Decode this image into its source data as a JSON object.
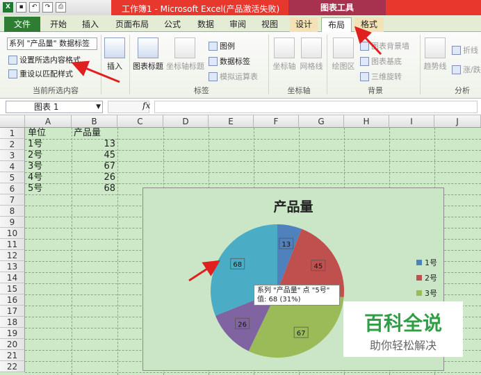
{
  "window": {
    "title": "工作簿1 - Microsoft Excel(产品激活失败)",
    "chart_tools_label": "图表工具",
    "qat_icons": [
      "excel-app-icon",
      "save-icon",
      "undo-icon",
      "redo-icon",
      "print-preview-icon"
    ]
  },
  "tabs": [
    "文件",
    "开始",
    "插入",
    "页面布局",
    "公式",
    "数据",
    "审阅",
    "视图",
    "设计",
    "布局",
    "格式"
  ],
  "active_tab": "布局",
  "ribbon": {
    "current_selection": {
      "dropdown_value": "系列 \"产品量\" 数据标签",
      "format_selection": "设置所选内容格式",
      "reset_style": "重设以匹配样式",
      "group_label": "当前所选内容"
    },
    "insert": {
      "label": "插入"
    },
    "labels": {
      "chart_title": "图表标题",
      "axis_title": "坐标轴标题",
      "legend": "图例",
      "data_labels": "数据标签",
      "data_table": "模拟运算表",
      "group_label": "标签"
    },
    "axes": {
      "axes": "坐标轴",
      "gridlines": "网格线",
      "group_label": "坐标轴"
    },
    "background": {
      "plot_area": "绘图区",
      "chart_wall": "图表背景墙",
      "chart_floor": "图表基底",
      "rotation": "三维旋转",
      "group_label": "背景"
    },
    "analysis": {
      "trendline": "趋势线",
      "lines": "折线",
      "updown": "涨/跌",
      "group_label": "分析"
    }
  },
  "formula_bar": {
    "name_box": "图表 1",
    "fx": "fx",
    "formula": ""
  },
  "sheet": {
    "columns": [
      "A",
      "B",
      "C",
      "D",
      "E",
      "F",
      "G",
      "H",
      "I",
      "J"
    ],
    "rows": [
      "1",
      "2",
      "3",
      "4",
      "5",
      "6",
      "7",
      "8",
      "9",
      "10",
      "11",
      "12",
      "13",
      "14",
      "15",
      "16",
      "17",
      "18",
      "19",
      "20",
      "21",
      "22"
    ],
    "header": {
      "unit": "单位",
      "qty": "产品量"
    },
    "data": [
      {
        "unit": "1号",
        "qty": "13"
      },
      {
        "unit": "2号",
        "qty": "45"
      },
      {
        "unit": "3号",
        "qty": "67"
      },
      {
        "unit": "4号",
        "qty": "26"
      },
      {
        "unit": "5号",
        "qty": "68"
      }
    ]
  },
  "chart_data": {
    "type": "pie",
    "title": "产品量",
    "categories": [
      "1号",
      "2号",
      "3号",
      "4号",
      "5号"
    ],
    "values": [
      13,
      45,
      67,
      26,
      68
    ],
    "colors": [
      "#4f81bd",
      "#c0504d",
      "#9bbb59",
      "#8064a2",
      "#4bacc6"
    ],
    "legend": [
      "1号",
      "2号",
      "3号"
    ],
    "legend_placement": "right"
  },
  "tooltip": {
    "line1": "系列 \"产品量\" 点 \"5号\"",
    "line2": "值: 68 (31%)"
  },
  "watermark": {
    "title": "百科全说",
    "subtitle": "助你轻松解决"
  }
}
